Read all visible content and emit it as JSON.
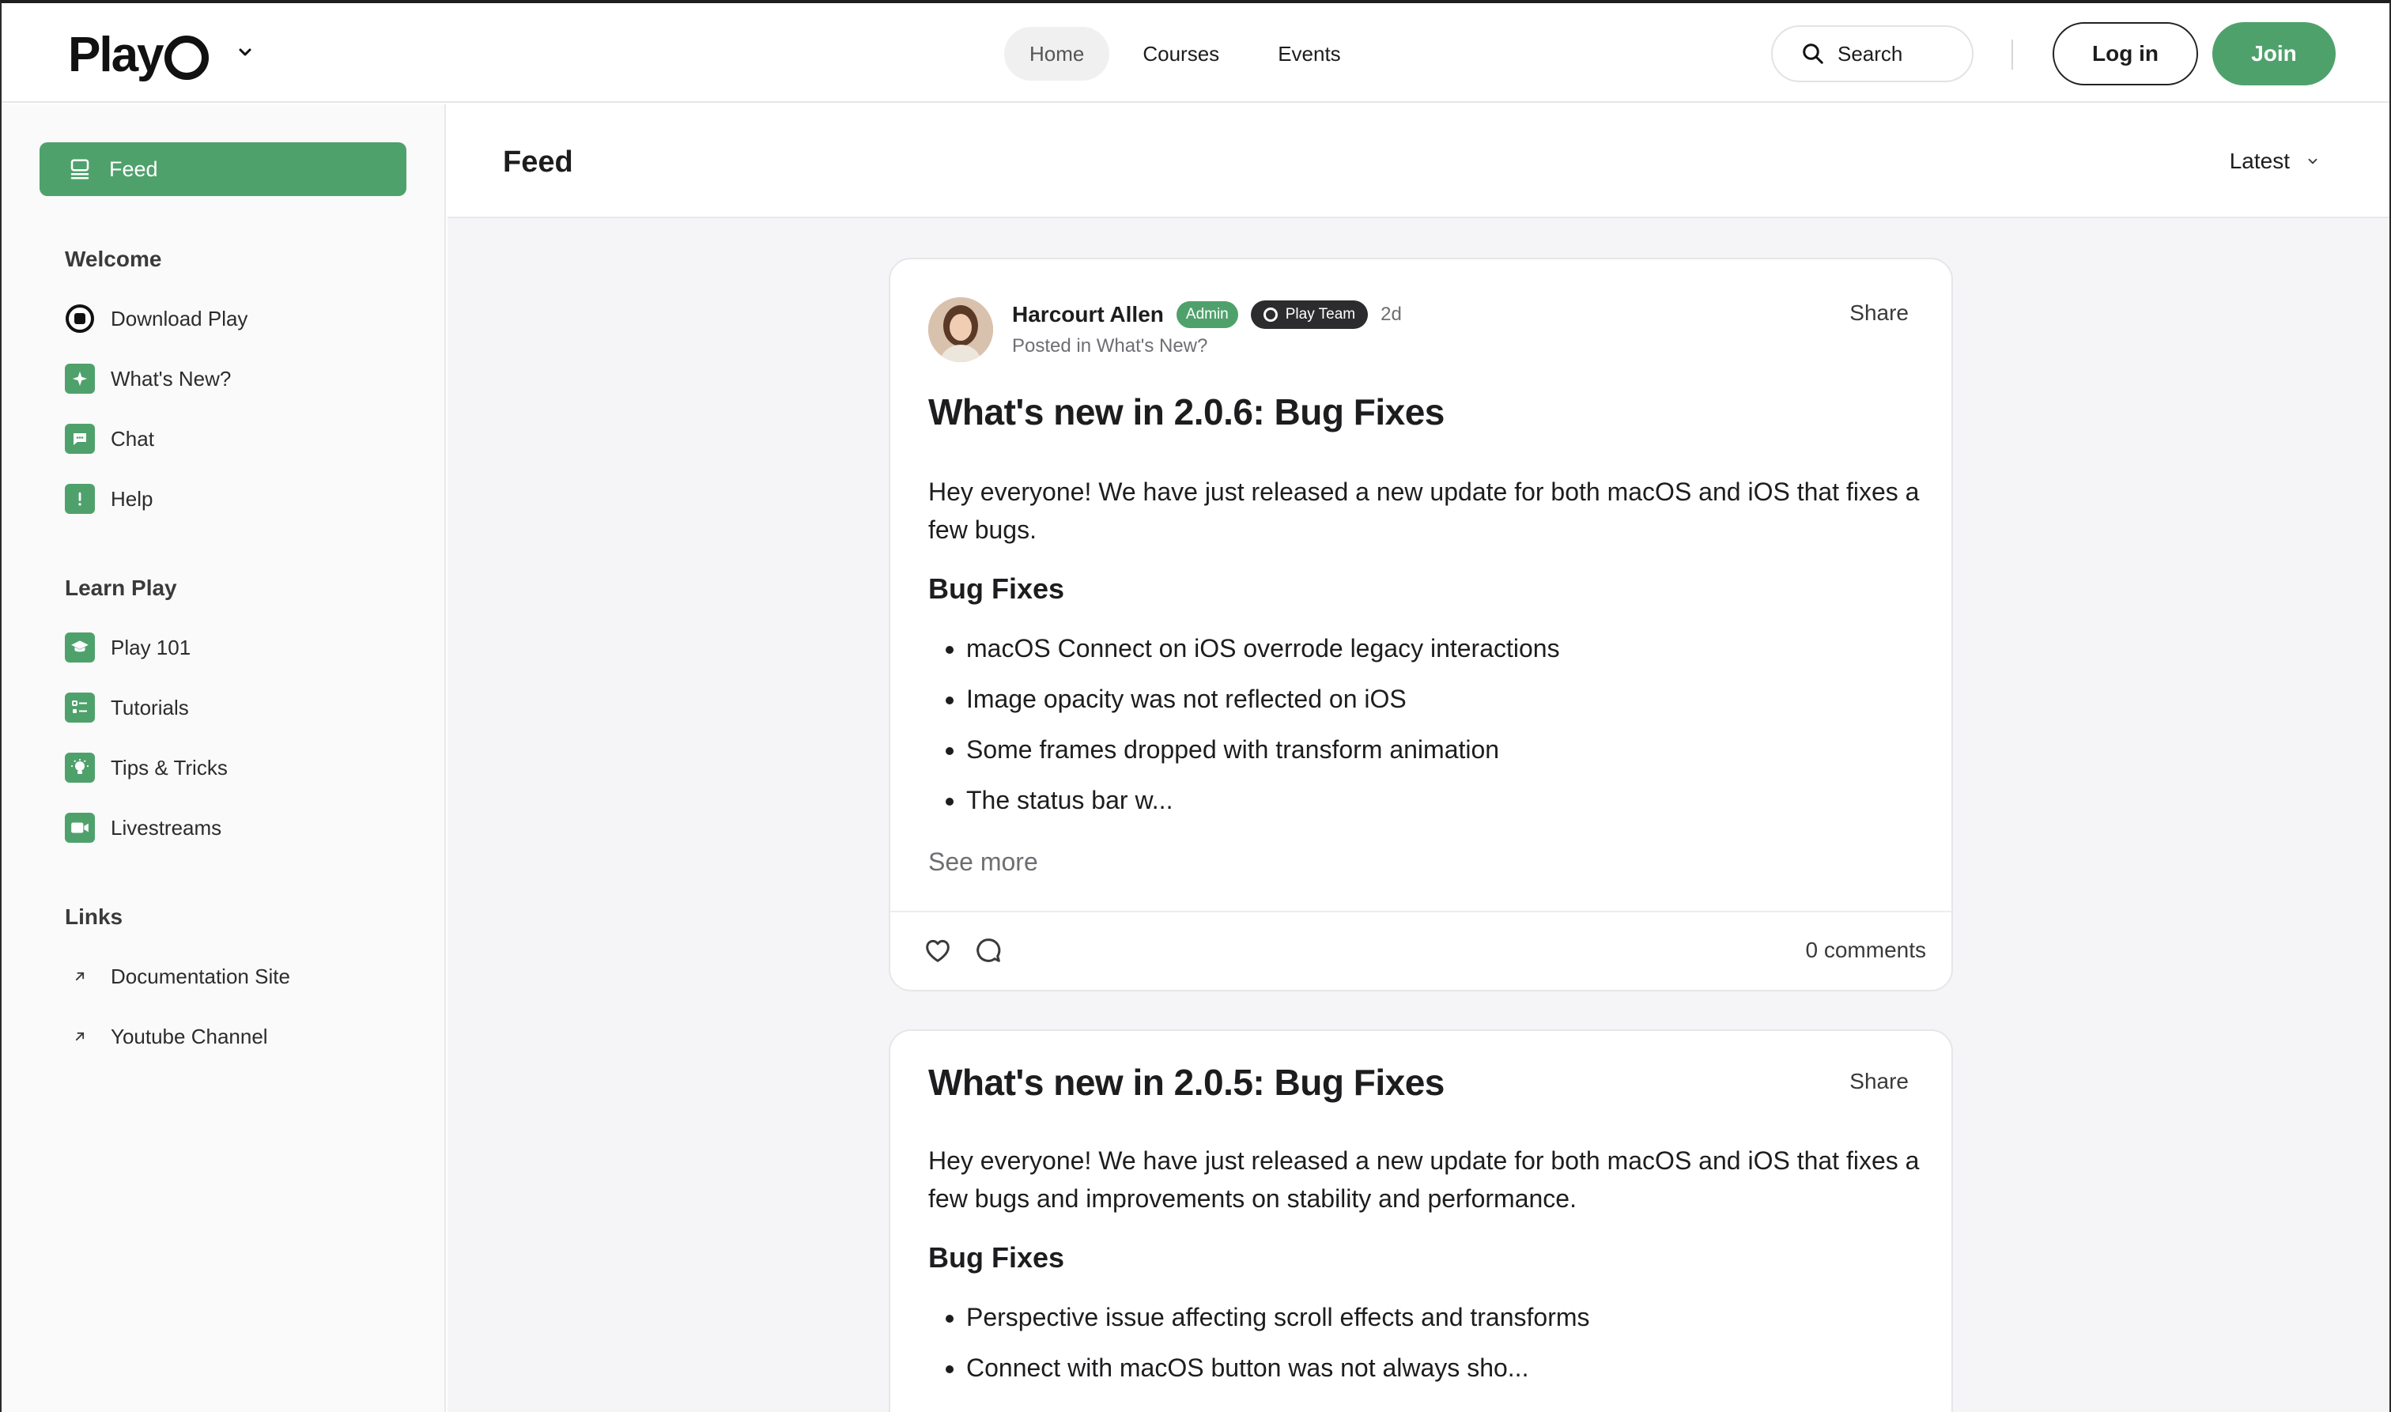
{
  "brand": {
    "name": "Play",
    "accent": "#4fa16c"
  },
  "header": {
    "nav": [
      {
        "label": "Home",
        "active": true
      },
      {
        "label": "Courses",
        "active": false
      },
      {
        "label": "Events",
        "active": false
      }
    ],
    "search_label": "Search",
    "login_label": "Log in",
    "join_label": "Join"
  },
  "sidebar": {
    "feed_label": "Feed",
    "sections": [
      {
        "title": "Welcome",
        "items": [
          {
            "label": "Download Play",
            "icon": "play-logo-icon"
          },
          {
            "label": "What's New?",
            "icon": "sparkle-icon"
          },
          {
            "label": "Chat",
            "icon": "chat-bubble-icon"
          },
          {
            "label": "Help",
            "icon": "exclamation-icon"
          }
        ]
      },
      {
        "title": "Learn Play",
        "items": [
          {
            "label": "Play 101",
            "icon": "graduation-cap-icon"
          },
          {
            "label": "Tutorials",
            "icon": "checklist-icon"
          },
          {
            "label": "Tips & Tricks",
            "icon": "lightbulb-icon"
          },
          {
            "label": "Livestreams",
            "icon": "video-camera-icon"
          }
        ]
      },
      {
        "title": "Links",
        "items": [
          {
            "label": "Documentation Site",
            "icon": "arrow-up-right-icon"
          },
          {
            "label": "Youtube Channel",
            "icon": "arrow-up-right-icon"
          }
        ]
      }
    ]
  },
  "main": {
    "title": "Feed",
    "sort_label": "Latest",
    "posts": [
      {
        "author": "Harcourt Allen",
        "role_badge": "Admin",
        "team_badge": "Play Team",
        "time": "2d",
        "posted_in": "Posted in What's New?",
        "share_label": "Share",
        "title": "What's new in 2.0.6: Bug Fixes",
        "body": "Hey everyone! We have just released a new update for both macOS and iOS that fixes a few bugs.",
        "subheading": "Bug Fixes",
        "bullets": [
          "macOS Connect on iOS overrode legacy interactions",
          "Image opacity was not reflected on iOS",
          "Some frames dropped with transform animation",
          "The status bar w..."
        ],
        "see_more": "See more",
        "comments": "0 comments"
      },
      {
        "share_label": "Share",
        "title": "What's new in 2.0.5: Bug Fixes",
        "body": "Hey everyone! We have just released a new update for both macOS and iOS that fixes a few bugs and improvements on stability and performance.",
        "subheading": "Bug Fixes",
        "bullets": [
          "Perspective issue affecting scroll effects and transforms",
          "Connect with macOS button was not always sho..."
        ]
      }
    ]
  }
}
